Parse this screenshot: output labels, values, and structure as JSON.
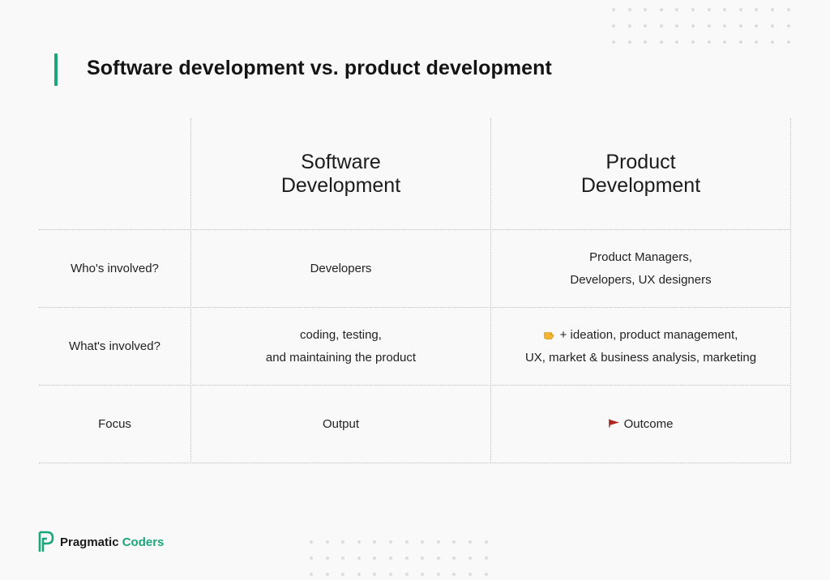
{
  "title": "Software development vs. product development",
  "headers": {
    "software": [
      "Software",
      "Development"
    ],
    "product": [
      "Product",
      "Development"
    ]
  },
  "rows": [
    {
      "label": "Who's involved?",
      "software": [
        "Developers"
      ],
      "product": [
        "Product Managers,",
        "Developers, UX designers"
      ]
    },
    {
      "label": "What's involved?",
      "software": [
        "coding, testing,",
        "and maintaining the product"
      ],
      "product": [
        "+ ideation, product management,",
        "UX, market & business analysis, marketing"
      ]
    },
    {
      "label": "Focus",
      "software": [
        "Output"
      ],
      "product": [
        "Outcome"
      ]
    }
  ],
  "icons": {
    "row2_product": "pointing-hand-icon",
    "row3_product": "red-flag-icon"
  },
  "brand": {
    "name": "Pragmatic",
    "accent": "Coders"
  },
  "colors": {
    "accent": "#1aa57a",
    "flag": "#b3261e",
    "hand": "#f2b632"
  }
}
